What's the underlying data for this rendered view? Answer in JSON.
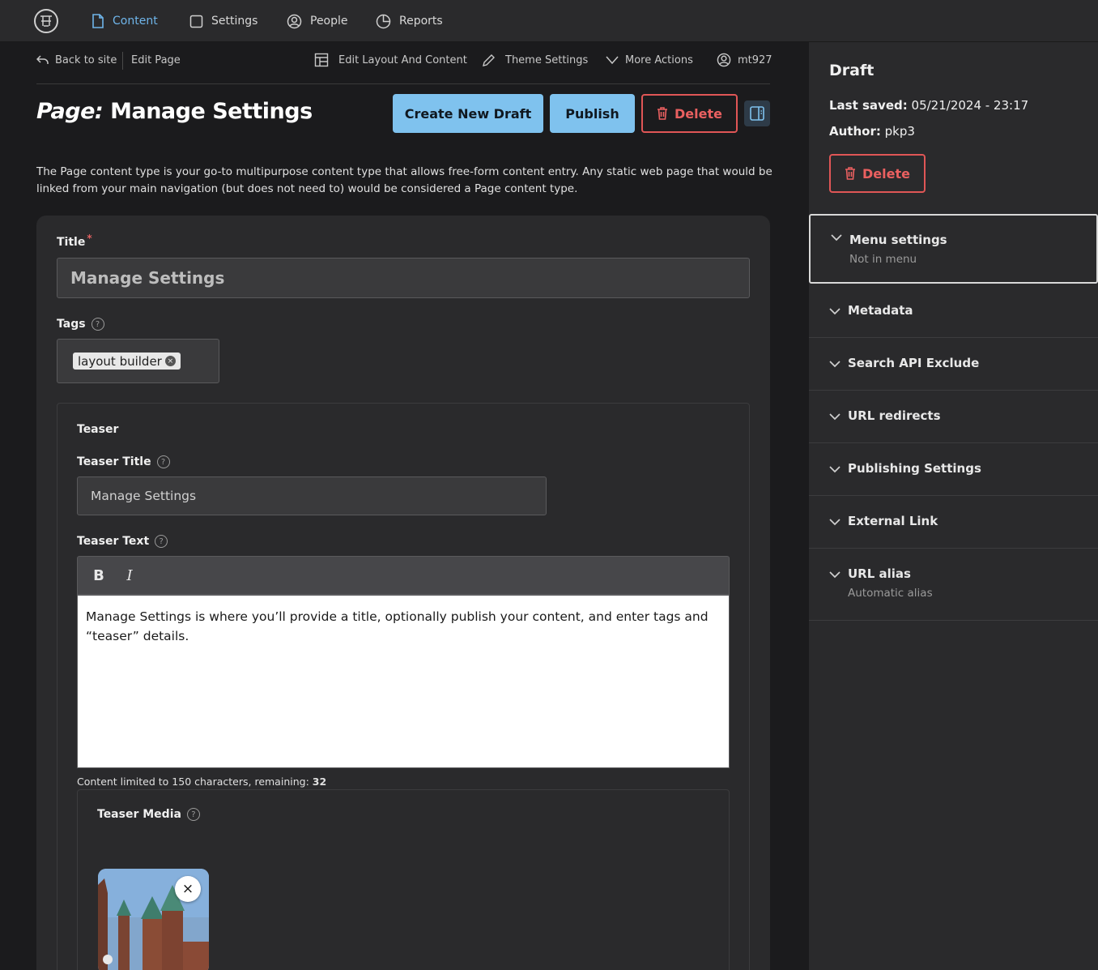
{
  "nav": {
    "items": [
      {
        "label": "Content",
        "icon": "document-icon",
        "active": true
      },
      {
        "label": "Settings",
        "icon": "square-icon"
      },
      {
        "label": "People",
        "icon": "user-circle-icon"
      },
      {
        "label": "Reports",
        "icon": "pie-chart-icon"
      }
    ]
  },
  "subbar": {
    "back": "Back to site",
    "edit_page": "Edit Page",
    "edit_layout": "Edit Layout And Content",
    "theme_settings": "Theme Settings",
    "more_actions": "More Actions",
    "user": "mt927"
  },
  "page": {
    "title_prefix": "Page:",
    "title": "Manage Settings",
    "description": "The Page content type is your go-to multipurpose content type that allows free-form content entry. Any static web page that would be linked from your main navigation (but does not need to) would be considered a Page content type."
  },
  "actions": {
    "create_draft": "Create New Draft",
    "publish": "Publish",
    "delete": "Delete"
  },
  "form": {
    "title_label": "Title",
    "title_required_mark": "*",
    "title_value": "Manage Settings",
    "tags_label": "Tags",
    "tags": [
      "layout builder"
    ],
    "teaser_heading": "Teaser",
    "teaser_title_label": "Teaser Title",
    "teaser_title_value": "Manage Settings",
    "teaser_text_label": "Teaser Text",
    "bold": "B",
    "italic": "I",
    "teaser_text_value": "Manage Settings is where you’ll provide a title, optionally publish your content, and enter tags and “teaser” details.",
    "limit_text": "Content limited to 150 characters, remaining: ",
    "limit_remaining": "32",
    "teaser_media_label": "Teaser Media",
    "help_mark": "?",
    "remove_mark": "×"
  },
  "sidebar": {
    "status": "Draft",
    "last_saved_label": "Last saved:",
    "last_saved_value": "05/21/2024 - 23:17",
    "author_label": "Author:",
    "author_value": "pkp3",
    "delete": "Delete",
    "sections": [
      {
        "title": "Menu settings",
        "subtitle": "Not in menu"
      },
      {
        "title": "Metadata"
      },
      {
        "title": "Search API Exclude"
      },
      {
        "title": "URL redirects"
      },
      {
        "title": "Publishing Settings"
      },
      {
        "title": "External Link"
      },
      {
        "title": "URL alias",
        "subtitle": "Automatic alias"
      }
    ]
  },
  "colors": {
    "accent": "#7fc2ee",
    "danger": "#e05656",
    "nav_active": "#6fb5ea"
  }
}
